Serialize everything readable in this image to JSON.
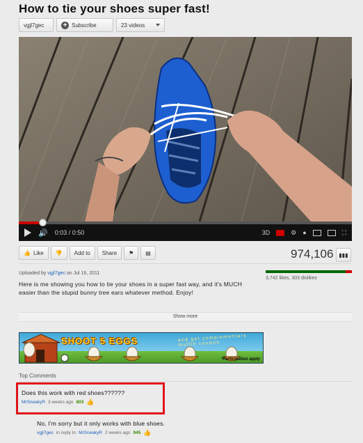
{
  "video_title": "How to tie your shoes super fast!",
  "channel": {
    "name": "vgjl7gec",
    "subscribe_label": "Subscribe",
    "videos_label": "23 videos"
  },
  "player": {
    "time": "0:03 / 0:50",
    "progress": 0.07,
    "quality": "3D"
  },
  "actions": {
    "like_label": "Like",
    "add_to_label": "Add to",
    "share_label": "Share"
  },
  "view_count": "974,106",
  "upload": {
    "prefix": "Uploaded by",
    "user": "vgjl7gec",
    "date_text": "on Jul 16, 2011"
  },
  "description": "Here is me showing you how to tie your shoes in a super fast way, and it's MUCH easier than the stupid bunny tree ears whatever method. Enjoy!",
  "likes": {
    "text": "3,742 likes, 303 dislikes",
    "ratio": 0.925
  },
  "show_more_label": "Show more",
  "ad": {
    "title": "SHOOT 5 EGGS",
    "subtitle": "and get complementary muffin coupon",
    "participation": "*Participation apply"
  },
  "comments_heading": "Top Comments",
  "comments": [
    {
      "text": "Does this work with red shoes??????",
      "author": "MrSneakyR",
      "age": "3 weeks ago",
      "score": "803"
    },
    {
      "text": "No, I'm sorry but it only works with blue shoes.",
      "author": "vgjl7gec",
      "reply_prefix": "in reply to",
      "reply_to": "MrSneakyR",
      "age": "2 weeks ago",
      "score": "945"
    }
  ],
  "colors": {
    "accent_red": "#e1121a",
    "link_blue": "#1c62b9",
    "like_green": "#006600"
  }
}
